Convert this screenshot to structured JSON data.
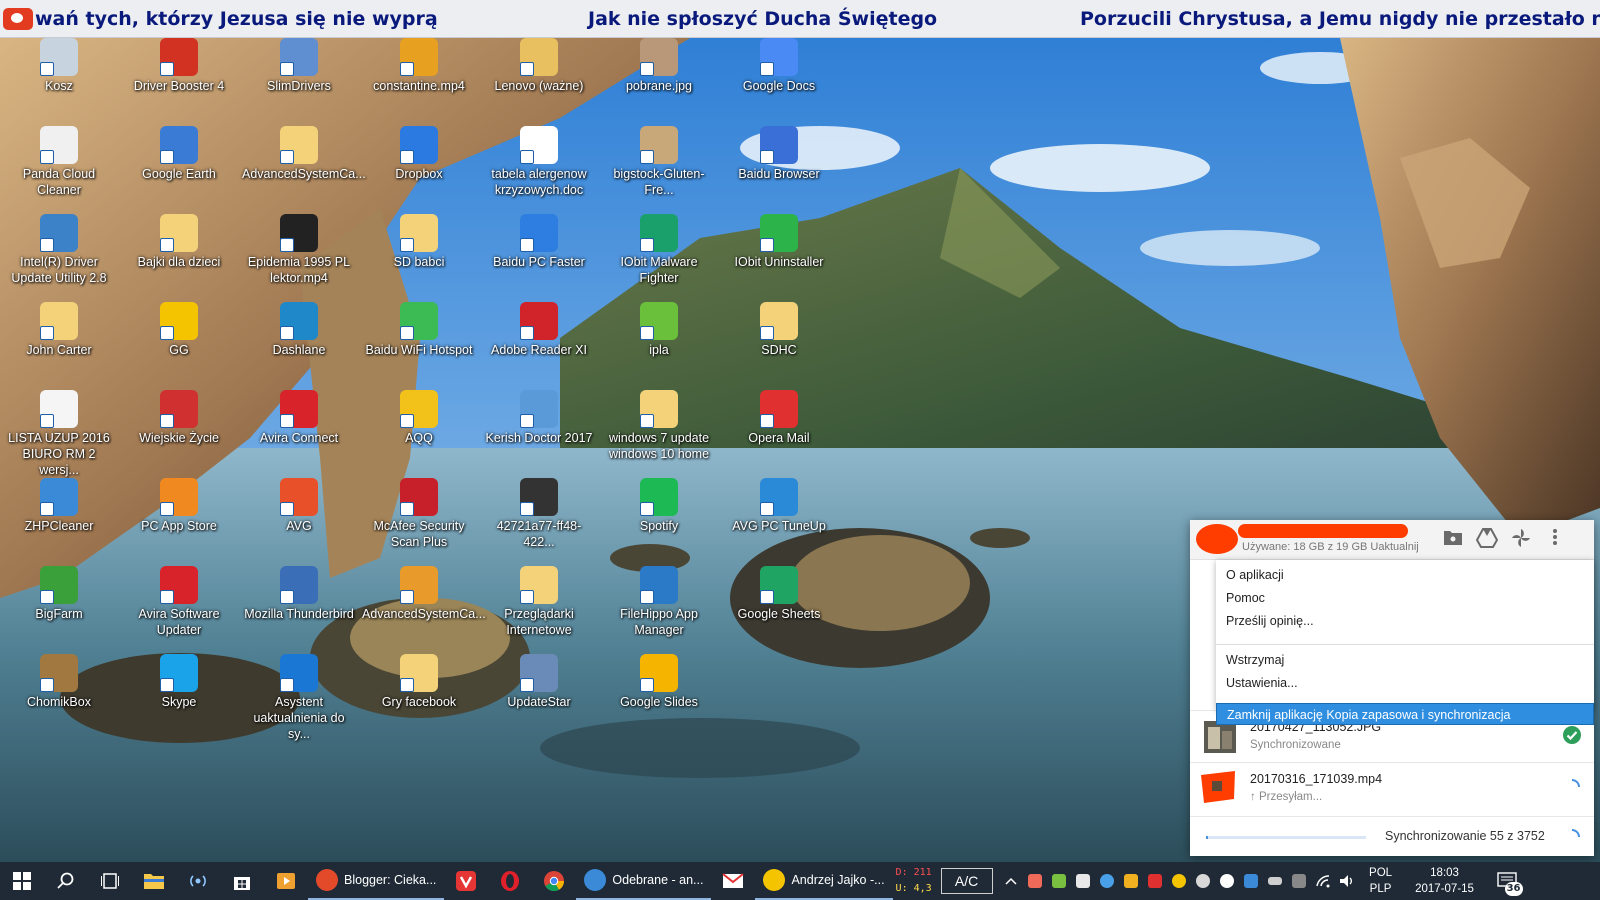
{
  "ticker": {
    "items": [
      "wań tych, którzy Jezusa się nie wyprą",
      "Jak nie spłoszyć Ducha Świętego",
      "Porzucili Chrystusa, a Jemu nigdy nie przestało na ni"
    ]
  },
  "desktop": {
    "icons": [
      {
        "label": "Kosz",
        "color": "#c7d3de"
      },
      {
        "label": "Driver Booster 4",
        "color": "#d23222"
      },
      {
        "label": "SlimDrivers",
        "color": "#5f8fd0"
      },
      {
        "label": "constantine.mp4",
        "color": "#e8a020"
      },
      {
        "label": "Lenovo (ważne)",
        "color": "#e8c060"
      },
      {
        "label": "pobrane.jpg",
        "color": "#b89878"
      },
      {
        "label": "Google Docs",
        "color": "#4a8af4"
      },
      {
        "label": "Panda Cloud Cleaner",
        "color": "#f0f0f0"
      },
      {
        "label": "Google Earth",
        "color": "#3a7bd5"
      },
      {
        "label": "AdvancedSystemCa...",
        "color": "#f3d27a"
      },
      {
        "label": "Dropbox",
        "color": "#2a7ae2"
      },
      {
        "label": "tabela alergenow krzyzowych.doc",
        "color": "#ffffff"
      },
      {
        "label": "bigstock-Gluten-Fre...",
        "color": "#c8a878"
      },
      {
        "label": "Baidu Browser",
        "color": "#3a6fd8"
      },
      {
        "label": "Intel(R) Driver Update Utility 2.8",
        "color": "#3b82c8"
      },
      {
        "label": "Bajki dla dzieci",
        "color": "#f3d27a"
      },
      {
        "label": "Epidemia 1995 PL lektor.mp4",
        "color": "#222222"
      },
      {
        "label": "SD babci",
        "color": "#f3d27a"
      },
      {
        "label": "Baidu PC Faster",
        "color": "#2d7ee0"
      },
      {
        "label": "IObit Malware Fighter",
        "color": "#1aa06a"
      },
      {
        "label": "IObit Uninstaller",
        "color": "#2cb34a"
      },
      {
        "label": "John Carter",
        "color": "#f3d27a"
      },
      {
        "label": "GG",
        "color": "#f5c400"
      },
      {
        "label": "Dashlane",
        "color": "#1e88c8"
      },
      {
        "label": "Baidu WiFi Hotspot",
        "color": "#3cba54"
      },
      {
        "label": "Adobe Reader XI",
        "color": "#d1232a"
      },
      {
        "label": "ipla",
        "color": "#6ac03a"
      },
      {
        "label": "SDHC",
        "color": "#f3d27a"
      },
      {
        "label": "LISTA UZUP 2016 BIURO RM 2 wersj...",
        "color": "#f5f5f5"
      },
      {
        "label": "Wiejskie Życie",
        "color": "#d03030"
      },
      {
        "label": "Avira Connect",
        "color": "#d8232a"
      },
      {
        "label": "AQQ",
        "color": "#f2c21a"
      },
      {
        "label": "Kerish Doctor 2017",
        "color": "#5a9ad8"
      },
      {
        "label": "windows 7 update windows 10 home",
        "color": "#f3d27a"
      },
      {
        "label": "Opera Mail",
        "color": "#e03030"
      },
      {
        "label": "ZHPCleaner",
        "color": "#3a8ad8"
      },
      {
        "label": "PC App Store",
        "color": "#f08a20"
      },
      {
        "label": "AVG",
        "color": "#e8502a"
      },
      {
        "label": "McAfee Security Scan Plus",
        "color": "#c8202a"
      },
      {
        "label": "42721a77-ff48-422...",
        "color": "#333333"
      },
      {
        "label": "Spotify",
        "color": "#1db954"
      },
      {
        "label": "AVG PC TuneUp",
        "color": "#2a8ad8"
      },
      {
        "label": "BigFarm",
        "color": "#3aa03a"
      },
      {
        "label": "Avira Software Updater",
        "color": "#d8232a"
      },
      {
        "label": "Mozilla Thunderbird",
        "color": "#3a6fb8"
      },
      {
        "label": "AdvancedSystemCa...",
        "color": "#e89a2a"
      },
      {
        "label": "Przeglądarki Internetowe",
        "color": "#f3d27a"
      },
      {
        "label": "FileHippo App Manager",
        "color": "#2a7ac8"
      },
      {
        "label": "Google Sheets",
        "color": "#1fa463"
      },
      {
        "label": "ChomikBox",
        "color": "#a07840"
      },
      {
        "label": "Skype",
        "color": "#1aa3e8"
      },
      {
        "label": "Asystent uaktualnienia do sy...",
        "color": "#1a78d4"
      },
      {
        "label": "Gry facebook",
        "color": "#f3d27a"
      },
      {
        "label": "UpdateStar",
        "color": "#6a8ab8"
      },
      {
        "label": "Google Slides",
        "color": "#f4b400"
      }
    ]
  },
  "backup_sync": {
    "usage": "Używane: 18 GB z 19 GB",
    "usage_link": "Uaktualnij",
    "header_icons": [
      "folder-icon",
      "drive-icon",
      "pinwheel-icon",
      "more-vert-icon"
    ],
    "menu": {
      "items": [
        "O aplikacji",
        "Pomoc",
        "Prześlij opinię...",
        "Wstrzymaj",
        "Ustawienia...",
        "Zamknij aplikację Kopia zapasowa i synchronizacja"
      ],
      "selected_index": 5
    },
    "files": [
      {
        "name": "20170427_113052.JPG",
        "status": "Synchronizowane",
        "state": "done"
      },
      {
        "name": "20170316_171039.mp4",
        "status": "↑ Przesyłam...",
        "state": "uploading"
      }
    ],
    "sync_text": "Synchronizowanie 55 z 3752",
    "sync_progress": 0.0146
  },
  "taskbar": {
    "apps": [
      {
        "label": "Blogger: Cieka...",
        "color": "#e24a2a"
      },
      {
        "label": "Odebrane - an...",
        "color": "#3a8ad8"
      },
      {
        "label": "Andrzej Jajko -...",
        "color": "#f5c400"
      }
    ],
    "meter_d": "D: 211",
    "meter_u": "U: 4,3 1",
    "ac_label": "A/C",
    "lang_top": "POL",
    "lang_bottom": "PLP",
    "time": "18:03",
    "date": "2017-07-15",
    "notification_count": "36"
  }
}
